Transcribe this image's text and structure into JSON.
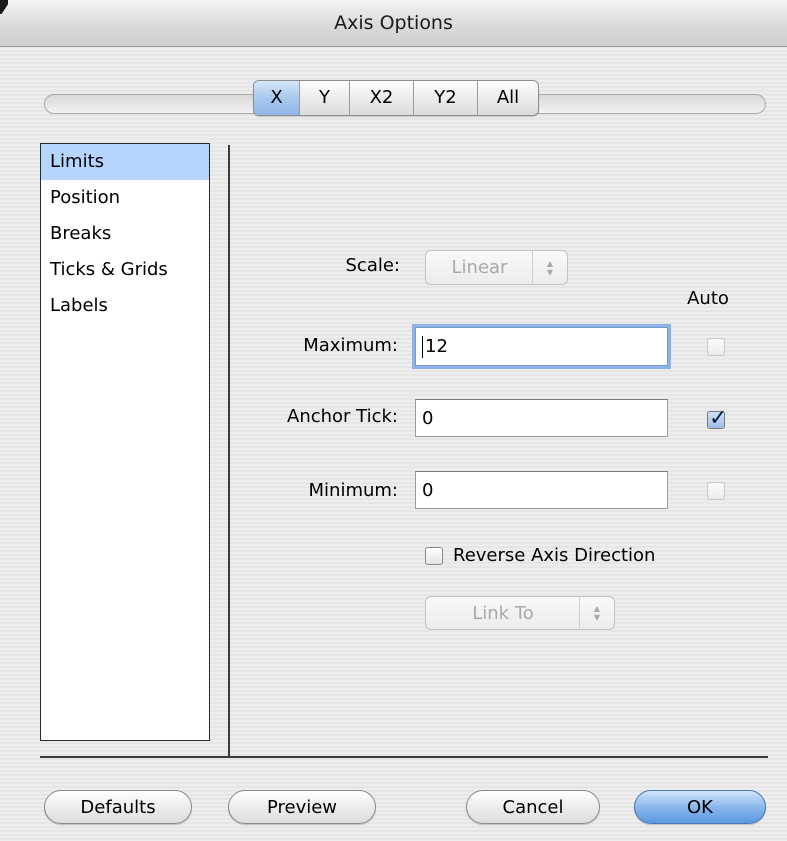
{
  "window": {
    "title": "Axis Options"
  },
  "axis_tabs": [
    {
      "label": "X",
      "selected": true
    },
    {
      "label": "Y",
      "selected": false
    },
    {
      "label": "X2",
      "selected": false
    },
    {
      "label": "Y2",
      "selected": false
    },
    {
      "label": "All",
      "selected": false
    }
  ],
  "categories": [
    {
      "label": "Limits",
      "selected": true
    },
    {
      "label": "Position",
      "selected": false
    },
    {
      "label": "Breaks",
      "selected": false
    },
    {
      "label": "Ticks & Grids",
      "selected": false
    },
    {
      "label": "Labels",
      "selected": false
    }
  ],
  "limits": {
    "scale_label": "Scale:",
    "scale_value": "Linear",
    "auto_label": "Auto",
    "maximum_label": "Maximum:",
    "maximum_value": "12",
    "maximum_auto": false,
    "anchor_label": "Anchor Tick:",
    "anchor_value": "0",
    "anchor_auto": true,
    "minimum_label": "Minimum:",
    "minimum_value": "0",
    "minimum_auto": false,
    "reverse_label": "Reverse Axis Direction",
    "reverse_checked": false,
    "link_to_label": "Link To"
  },
  "buttons": {
    "defaults": "Defaults",
    "preview": "Preview",
    "cancel": "Cancel",
    "ok": "OK"
  },
  "colors": {
    "selection": "#b5d5ff",
    "default_button": "#5c99e0"
  }
}
